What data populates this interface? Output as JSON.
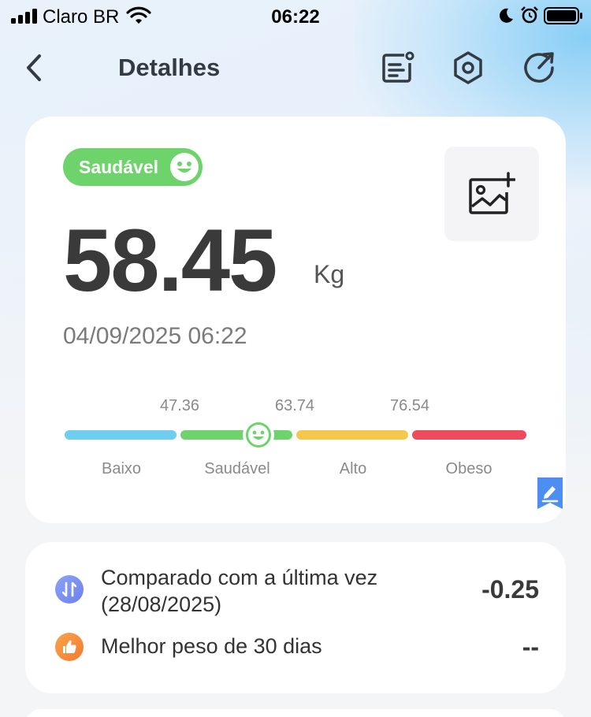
{
  "status_bar": {
    "carrier": "Claro BR",
    "time": "06:22"
  },
  "nav": {
    "title": "Detalhes",
    "icons": [
      "back-icon",
      "report-icon",
      "settings-icon",
      "share-icon"
    ]
  },
  "summary": {
    "status_badge": "Saudável",
    "weight": "58.45",
    "unit": "Kg",
    "datetime": "04/09/2025 06:22",
    "weight_value_kg": 58.45,
    "thresholds": [
      "47.36",
      "63.74",
      "76.54"
    ],
    "ranges": [
      {
        "label": "Baixo",
        "color": "#6fcdf0"
      },
      {
        "label": "Saudável",
        "color": "#6dd36a"
      },
      {
        "label": "Alto",
        "color": "#f5c84d"
      },
      {
        "label": "Obeso",
        "color": "#ef4b5f"
      }
    ]
  },
  "compare": {
    "last_label": "Comparado com a última vez",
    "last_date": "(28/08/2025)",
    "last_value": "-0.25",
    "best_label": "Melhor peso de 30 dias",
    "best_value": "--"
  },
  "colors": {
    "accent_green": "#6dd36a",
    "compare_icon": "#7b8ff2",
    "best_icon": "#f5913e",
    "edit_icon": "#4d8ef3"
  }
}
